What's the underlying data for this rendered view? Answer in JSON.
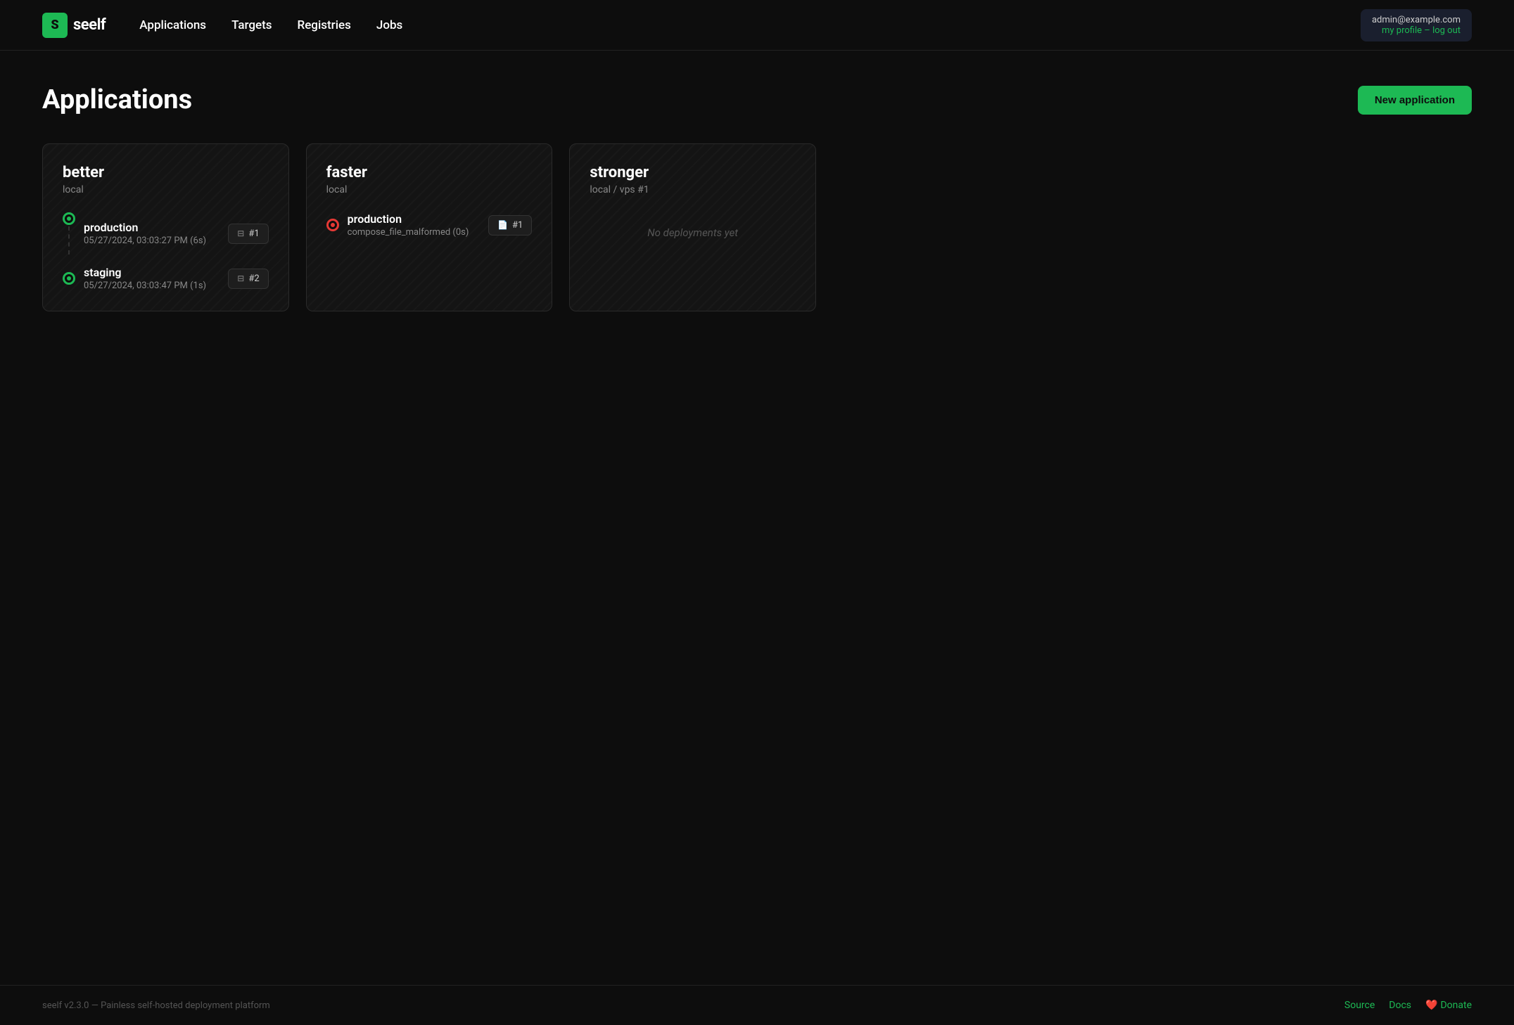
{
  "brand": {
    "logo_letter": "S",
    "logo_name": "seelf"
  },
  "nav": {
    "links": [
      {
        "label": "Applications",
        "href": "#"
      },
      {
        "label": "Targets",
        "href": "#"
      },
      {
        "label": "Registries",
        "href": "#"
      },
      {
        "label": "Jobs",
        "href": "#"
      }
    ],
    "user_email": "admin@example.com",
    "user_actions": "my profile – log out"
  },
  "page": {
    "title": "Applications",
    "new_button": "New application"
  },
  "apps": [
    {
      "name": "better",
      "target": "local",
      "deployments": [
        {
          "env": "production",
          "meta": "05/27/2024, 03:03:27 PM (6s)",
          "status": "success",
          "badge": "#1"
        },
        {
          "env": "staging",
          "meta": "05/27/2024, 03:03:47 PM (1s)",
          "status": "success",
          "badge": "#2"
        }
      ],
      "no_deployments": null
    },
    {
      "name": "faster",
      "target": "local",
      "deployments": [
        {
          "env": "production",
          "meta": "compose_file_malformed (0s)",
          "status": "error",
          "badge": "#1"
        }
      ],
      "no_deployments": null
    },
    {
      "name": "stronger",
      "target": "local / vps #1",
      "deployments": [],
      "no_deployments": "No deployments yet"
    }
  ],
  "footer": {
    "left": "seelf v2.3.0 — Painless self-hosted deployment platform",
    "source": "Source",
    "docs": "Docs",
    "donate": "Donate"
  }
}
